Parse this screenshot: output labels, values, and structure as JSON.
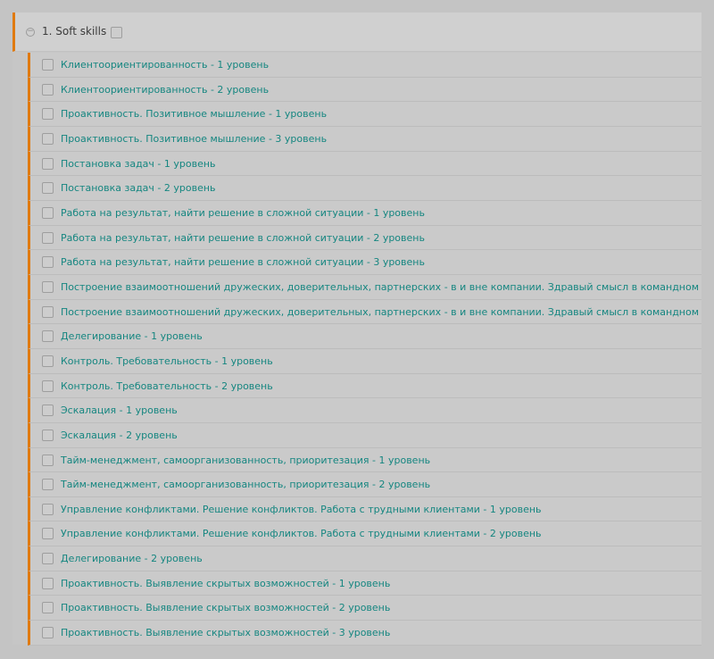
{
  "group": {
    "title": "1. Soft skills",
    "collapse_symbol": "−"
  },
  "colors": {
    "accent": "#e07a10",
    "link": "#158680"
  },
  "items": [
    "Клиентоориентированность - 1 уровень",
    "Клиентоориентированность - 2 уровень",
    "Проактивность. Позитивное мышление - 1 уровень",
    "Проактивность. Позитивное мышление - 3 уровень",
    "Постановка задач - 1 уровень",
    "Постановка задач - 2 уровень",
    "Работа на результат, найти решение в сложной ситуации - 1 уровень",
    "Работа на результат, найти решение в сложной ситуации - 2 уровень",
    "Работа на результат, найти решение в сложной ситуации - 3 уровень",
    "Построение взаимоотношений дружеских, доверительных, партнерских - в и вне компании. Здравый смысл в командном",
    "Построение взаимоотношений дружеских, доверительных, партнерских - в и вне компании. Здравый смысл в командном",
    "Делегирование - 1 уровень",
    "Контроль. Требовательность - 1 уровень",
    "Контроль. Требовательность - 2 уровень",
    "Эскалация - 1 уровень",
    "Эскалация - 2 уровень",
    "Тайм-менеджмент, самоорганизованность, приоритезация - 1 уровень",
    "Тайм-менеджмент, самоорганизованность, приоритезация - 2 уровень",
    "Управление конфликтами. Решение конфликтов. Работа с трудными клиентами - 1 уровень",
    "Управление конфликтами. Решение конфликтов. Работа с трудными клиентами - 2 уровень",
    "Делегирование - 2 уровень",
    "Проактивность. Выявление скрытых возможностей - 1 уровень",
    "Проактивность. Выявление скрытых возможностей - 2 уровень",
    "Проактивность. Выявление скрытых возможностей - 3 уровень"
  ]
}
